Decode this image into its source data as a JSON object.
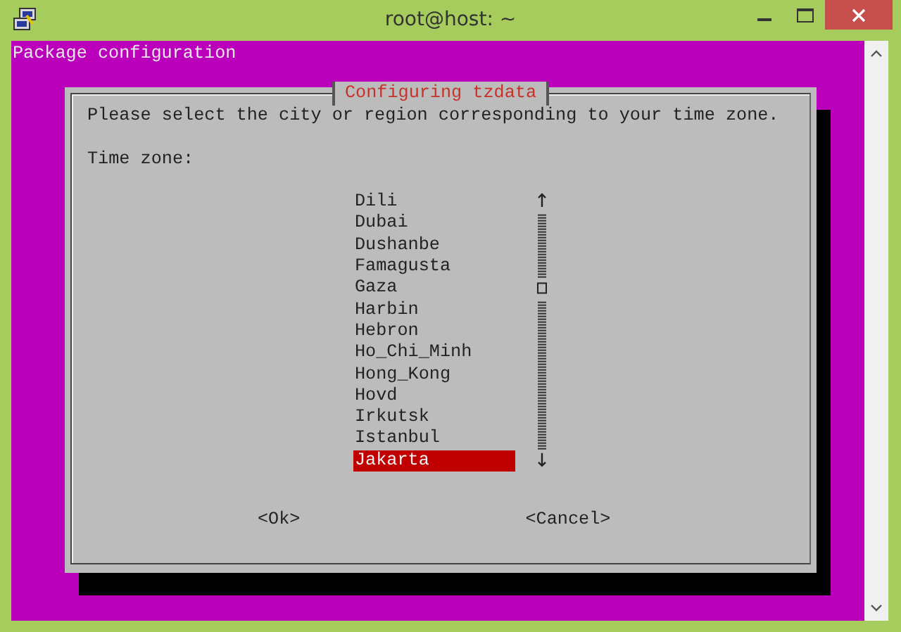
{
  "window": {
    "title": "root@host: ~"
  },
  "terminal": {
    "header": "Package configuration"
  },
  "dialog": {
    "title": "Configuring tzdata",
    "prompt": "Please select the city or region corresponding to your time zone.",
    "label": "Time zone:",
    "items": [
      {
        "label": "Dili",
        "selected": false
      },
      {
        "label": "Dubai",
        "selected": false
      },
      {
        "label": "Dushanbe",
        "selected": false
      },
      {
        "label": "Famagusta",
        "selected": false
      },
      {
        "label": "Gaza",
        "selected": false
      },
      {
        "label": "Harbin",
        "selected": false
      },
      {
        "label": "Hebron",
        "selected": false
      },
      {
        "label": "Ho_Chi_Minh",
        "selected": false
      },
      {
        "label": "Hong_Kong",
        "selected": false
      },
      {
        "label": "Hovd",
        "selected": false
      },
      {
        "label": "Irkutsk",
        "selected": false
      },
      {
        "label": "Istanbul",
        "selected": false
      },
      {
        "label": "Jakarta",
        "selected": true
      }
    ],
    "buttons": [
      "<Ok>",
      "<Cancel>"
    ]
  }
}
